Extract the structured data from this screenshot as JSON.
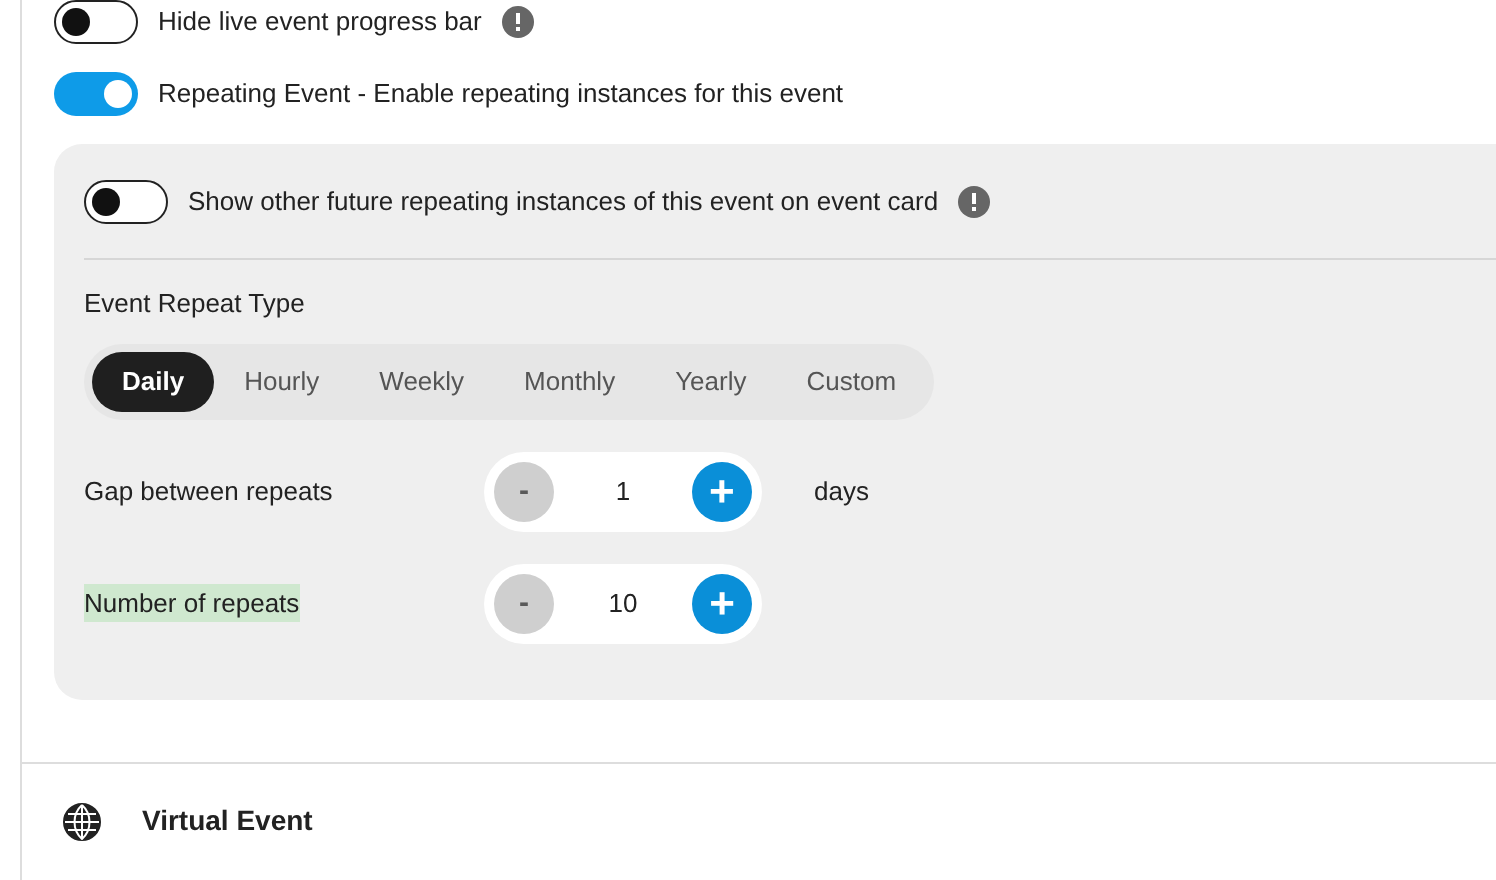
{
  "toggles": [
    {
      "label": "Hide live event progress bar",
      "on": false,
      "info": true
    },
    {
      "label": "Repeating Event - Enable repeating instances for this event",
      "on": true,
      "info": false
    }
  ],
  "repeat_panel": {
    "show_future": {
      "label": "Show other future repeating instances of this event on event card",
      "on": false
    },
    "repeat_type_label": "Event Repeat Type",
    "repeat_types": [
      {
        "label": "Daily",
        "selected": true
      },
      {
        "label": "Hourly",
        "selected": false
      },
      {
        "label": "Weekly",
        "selected": false
      },
      {
        "label": "Monthly",
        "selected": false
      },
      {
        "label": "Yearly",
        "selected": false
      },
      {
        "label": "Custom",
        "selected": false
      }
    ],
    "steppers": [
      {
        "label": "Gap between repeats",
        "minus": "-",
        "value": "1",
        "plus": "+",
        "unit": "days",
        "highlighted": false
      },
      {
        "label": "Number of repeats",
        "minus": "-",
        "value": "10",
        "plus": "+",
        "highlighted": true
      }
    ]
  },
  "section": {
    "title": "Virtual Event"
  }
}
